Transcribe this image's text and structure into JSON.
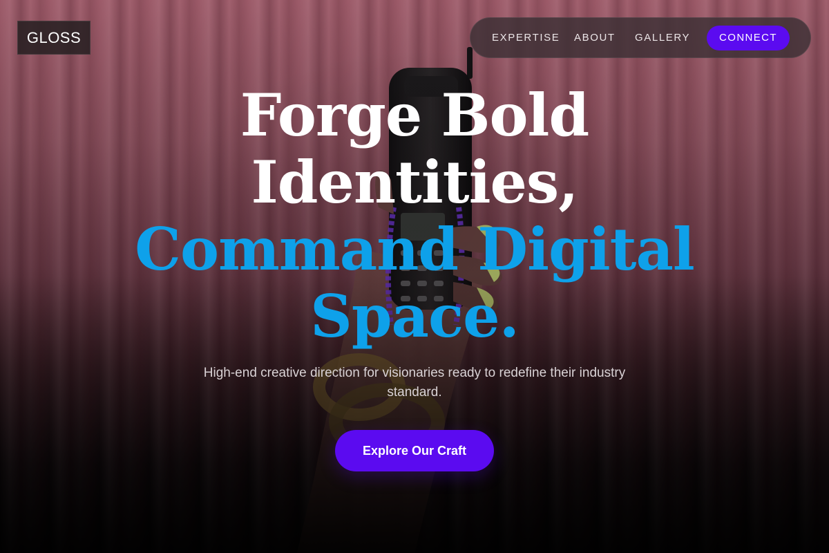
{
  "brand": {
    "logo_text": "GLOSS"
  },
  "nav": {
    "items": [
      {
        "label": "EXPERTISE"
      },
      {
        "label": "ABOUT"
      },
      {
        "label": "GALLERY"
      }
    ],
    "cta_label": "CONNECT"
  },
  "hero": {
    "headline_lines": [
      "Forge Bold",
      "Identities,"
    ],
    "headline_accent_lines": [
      "Command Digital",
      "Space."
    ],
    "subtitle": "High-end creative direction for visionaries ready to redefine their industry standard.",
    "cta_label": "Explore Our Craft",
    "background_image": "hand-holding-retro-mobile-phone-against-pink-curtain"
  },
  "colors": {
    "accent_purple": "#5b0bf0",
    "headline_blue": "#0ea1ea",
    "text_white": "#ffffff",
    "background_dark": "#0c0a0b"
  }
}
